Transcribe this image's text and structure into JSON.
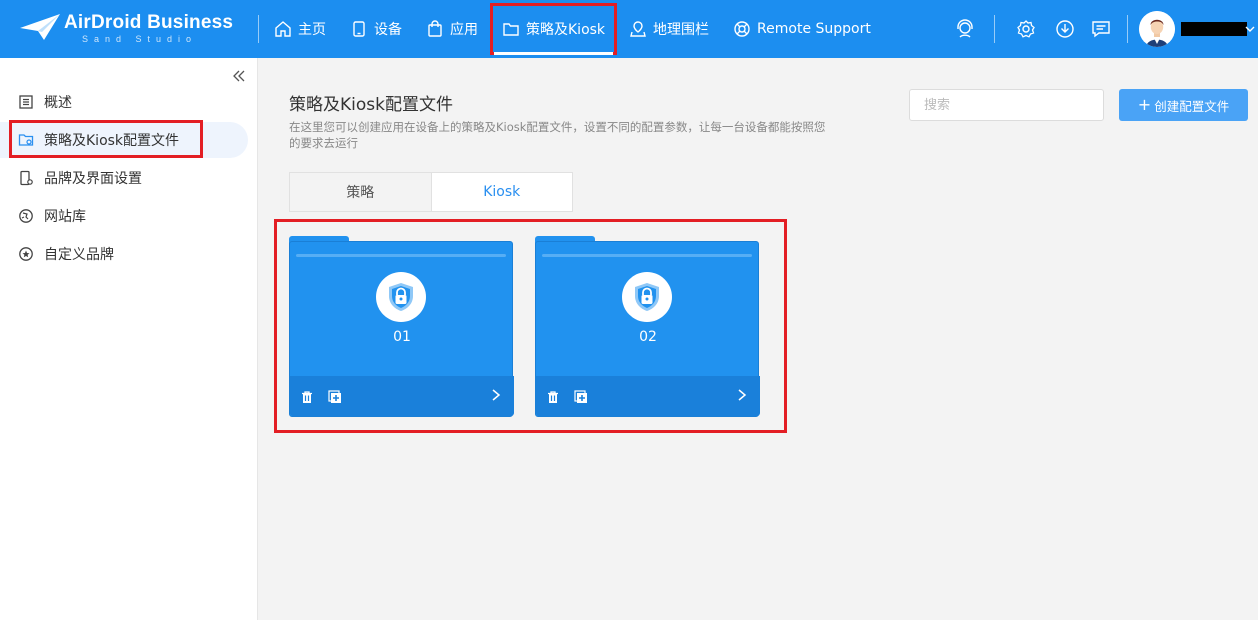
{
  "brand": {
    "name": "AirDroid Business",
    "sub": "Sand Studio"
  },
  "nav": [
    {
      "label": "主页",
      "icon": "home-icon"
    },
    {
      "label": "设备",
      "icon": "tablet-icon"
    },
    {
      "label": "应用",
      "icon": "shopping-bag-icon"
    },
    {
      "label": "策略及Kiosk",
      "icon": "folder-icon"
    },
    {
      "label": "地理围栏",
      "icon": "map-pin-icon"
    },
    {
      "label": "Remote Support",
      "icon": "lifebuoy-icon"
    }
  ],
  "topbar_icons": [
    "support-agent-icon",
    "settings-gear-icon",
    "download-icon",
    "message-icon"
  ],
  "sidebar": {
    "items": [
      {
        "label": "概述",
        "icon": "list-doc-icon"
      },
      {
        "label": "策略及Kiosk配置文件",
        "icon": "folder-settings-icon"
      },
      {
        "label": "品牌及界面设置",
        "icon": "phone-settings-icon"
      },
      {
        "label": "网站库",
        "icon": "globe-icon"
      },
      {
        "label": "自定义品牌",
        "icon": "star-circle-icon"
      }
    ]
  },
  "main": {
    "title": "策略及Kiosk配置文件",
    "description": "在这里您可以创建应用在设备上的策略及Kiosk配置文件，设置不同的配置参数，让每一台设备都能按照您的要求去运行",
    "search_placeholder": "搜索",
    "create_button": "创建配置文件",
    "tabs": [
      {
        "label": "策略"
      },
      {
        "label": "Kiosk"
      }
    ],
    "cards": [
      {
        "name": "01"
      },
      {
        "name": "02"
      }
    ]
  },
  "colors": {
    "topbar": "#1c8ef0",
    "accent": "#2a8ff0",
    "card": "#2192ef",
    "highlight": "#e31e24"
  }
}
